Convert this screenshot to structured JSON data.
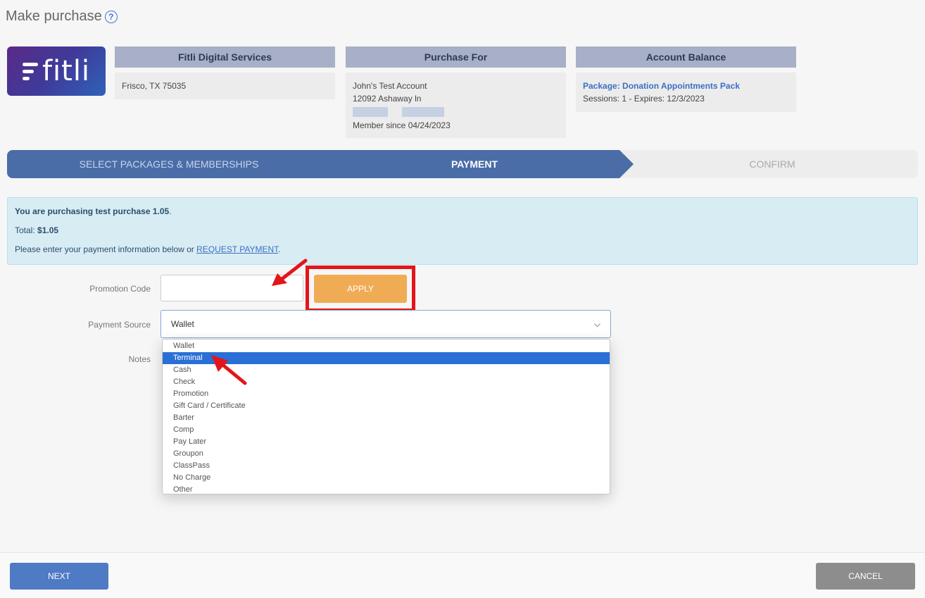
{
  "page": {
    "title": "Make purchase",
    "help_icon": "question-circle-icon"
  },
  "logo": {
    "text": "fitli"
  },
  "cards": {
    "business": {
      "header": "Fitli Digital Services",
      "address": "Frisco, TX 75035"
    },
    "purchase_for": {
      "header": "Purchase For",
      "name": "John's Test Account",
      "street": "12092 Ashaway ln",
      "member_since": "Member since 04/24/2023"
    },
    "balance": {
      "header": "Account Balance",
      "package": "Package: Donation Appointments Pack",
      "sessions": "Sessions: 1 - Expires: 12/3/2023"
    }
  },
  "steps": [
    {
      "label": "SELECT PACKAGES & MEMBERSHIPS",
      "state": "done"
    },
    {
      "label": "PAYMENT",
      "state": "active"
    },
    {
      "label": "CONFIRM",
      "state": "pending"
    }
  ],
  "info": {
    "purchasing_prefix": "You are purchasing",
    "item": "test purchase 1.05",
    "total_label": "Total:",
    "total_value": "$1.05",
    "instructions_prefix": "Please enter your payment information below or",
    "request_link": "REQUEST PAYMENT"
  },
  "form": {
    "promo_label": "Promotion Code",
    "promo_value": "",
    "apply_label": "APPLY",
    "source_label": "Payment Source",
    "source_value": "Wallet",
    "notes_label": "Notes",
    "source_options": [
      "Wallet",
      "Terminal",
      "Cash",
      "Check",
      "Promotion",
      "Gift Card / Certificate",
      "Barter",
      "Comp",
      "Pay Later",
      "Groupon",
      "ClassPass",
      "No Charge",
      "Other"
    ],
    "highlighted_option": "Terminal"
  },
  "footer": {
    "next_label": "NEXT",
    "cancel_label": "CANCEL"
  },
  "colors": {
    "step_active": "#4a6da7",
    "apply": "#f0ac55",
    "annotation_red": "#e3151a",
    "next": "#4f7ac4",
    "cancel": "#8d8d8d",
    "option_highlight": "#2a6fd6"
  }
}
